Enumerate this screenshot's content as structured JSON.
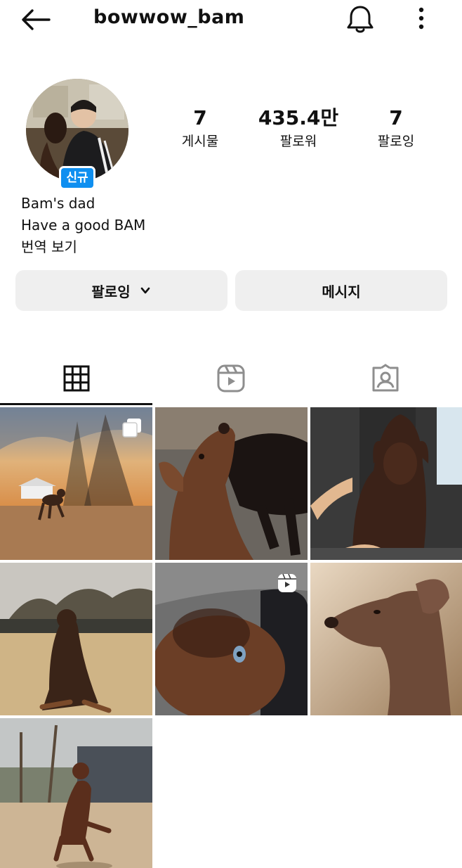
{
  "header": {
    "username": "bowwow_bam"
  },
  "profile": {
    "badge": "신규",
    "stats": [
      {
        "value": "7",
        "label": "게시물"
      },
      {
        "value": "435.4만",
        "label": "팔로워"
      },
      {
        "value": "7",
        "label": "팔로잉"
      }
    ],
    "bio": {
      "name": "Bam's dad",
      "text": "Have a good BAM",
      "translate": "번역 보기"
    }
  },
  "actions": {
    "following_label": "팔로잉",
    "message_label": "메시지"
  },
  "tabs": [
    {
      "icon": "grid-icon",
      "selected": true
    },
    {
      "icon": "reels-icon",
      "selected": false
    },
    {
      "icon": "tagged-icon",
      "selected": false
    }
  ],
  "posts": [
    {
      "badge": "multi-photo-icon"
    },
    {
      "badge": ""
    },
    {
      "badge": ""
    },
    {
      "badge": ""
    },
    {
      "badge": "reel-icon"
    },
    {
      "badge": ""
    },
    {
      "badge": ""
    }
  ],
  "colors": {
    "badge_blue": "#0f8ff0",
    "button_bg": "#efefef"
  }
}
